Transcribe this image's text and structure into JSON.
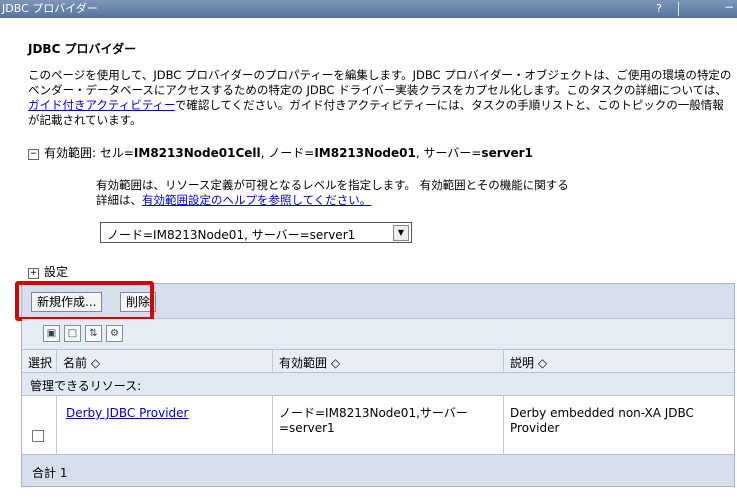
{
  "window": {
    "title": "JDBC プロバイダー",
    "help_label": "?",
    "minimize_label": "−"
  },
  "panel": {
    "title": "JDBC プロバイダー",
    "description_pre": "このページを使用して、JDBC プロバイダーのプロパティーを編集します。JDBC プロバイダー・オブジェクトは、ご使用の環境の特定のベンダー・データベースにアクセスするための特定の JDBC ドライバー実装クラスをカプセル化します。このタスクの詳細については、",
    "description_link": "ガイド付きアクティビティー",
    "description_post": "で確認してください。ガイド付きアクティビティーには、タスクの手順リストと、このトピックの一般情報が記載されています。"
  },
  "scope": {
    "toggle_icon": "−",
    "label": "有効範囲: セル=",
    "cell": "IM8213Node01Cell",
    "node_label": ", ノード=",
    "node": "IM8213Node01",
    "server_label": ", サーバー=",
    "server": "server1",
    "help_pre": "有効範囲は、リソース定義が可視となるレベルを指定します。 有効範囲とその機能に関する詳細は、",
    "help_link": "有効範囲設定のヘルプを参照してください。",
    "selected": "ノード=IM8213Node01, サーバー=server1"
  },
  "settings": {
    "toggle_icon": "+",
    "label": "設定"
  },
  "buttons": {
    "new": "新規作成...",
    "delete": "削除"
  },
  "icons": [
    "select-all-icon",
    "deselect-all-icon",
    "filter-icon",
    "preferences-icon"
  ],
  "table": {
    "headers": {
      "select": "選択",
      "name": "名前 ◇",
      "scope": "有効範囲 ◇",
      "description": "説明 ◇"
    },
    "group_label": "管理できるリソース:",
    "rows": [
      {
        "name": "Derby JDBC Provider",
        "scope": "ノード=IM8213Node01,サーバー=server1",
        "description": "Derby embedded non-XA JDBC Provider"
      }
    ],
    "total": "合計 1"
  },
  "colors": {
    "titlebar": "#56739b",
    "link": "#0000cc",
    "highlight": "#d80000",
    "toolbar": "#d5deea"
  }
}
